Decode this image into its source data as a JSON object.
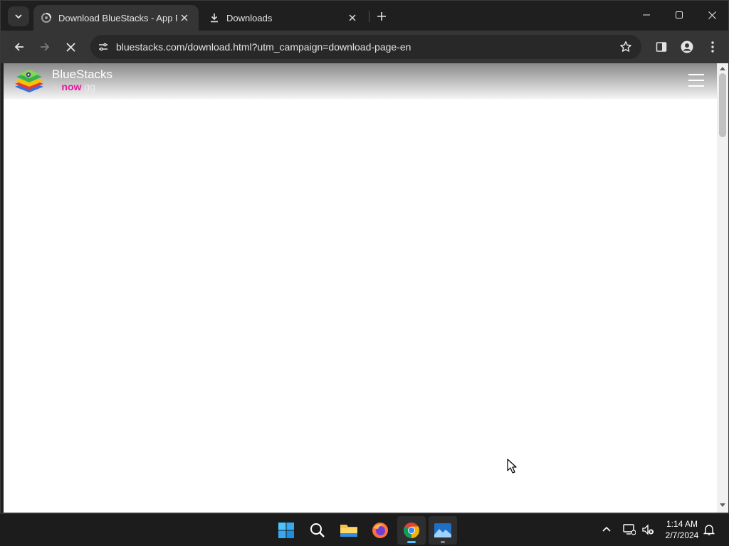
{
  "browser": {
    "tabs": [
      {
        "title": "Download BlueStacks - App Pla",
        "active": true
      },
      {
        "title": "Downloads",
        "active": false
      }
    ],
    "url": "bluestacks.com/download.html?utm_campaign=download-page-en",
    "icons": {
      "tab_search": "chevron-down-icon",
      "back": "arrow-left-icon",
      "forward": "arrow-right-icon",
      "stop": "close-icon",
      "site_info": "tune-icon",
      "bookmark": "star-icon",
      "side_panel": "side-panel-icon",
      "profile": "profile-icon",
      "menu": "more-vert-icon"
    }
  },
  "site": {
    "brand": "BlueStacks",
    "brand_by": "by",
    "brand_now": "now",
    "brand_gg": ".gg",
    "now_color": "#e8169f"
  },
  "taskbar": {
    "apps": [
      "start",
      "search",
      "file-explorer",
      "firefox",
      "chrome",
      "photos"
    ],
    "time": "1:14 AM",
    "date": "2/7/2024"
  },
  "colors": {
    "accent": "#4cc2ff",
    "chrome_dark": "#1f1f1f",
    "toolbar": "#353535"
  }
}
